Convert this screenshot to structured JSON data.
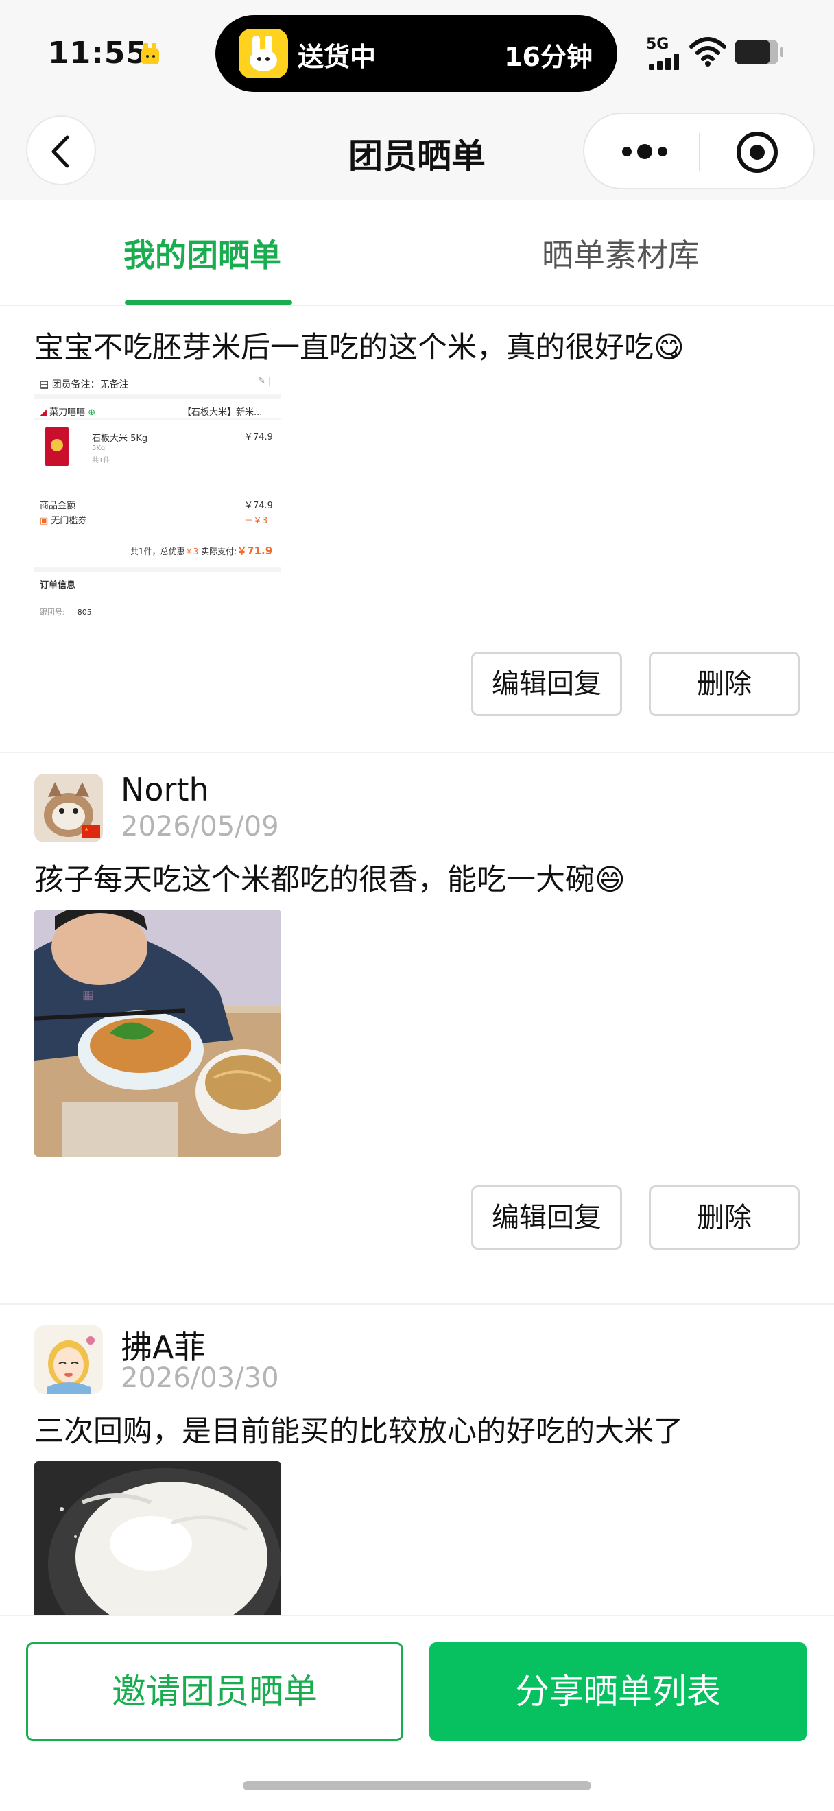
{
  "status_bar": {
    "time": "11:55",
    "island_text": "送货中",
    "island_eta": "16分钟",
    "network": "5G"
  },
  "nav": {
    "title": "团员晒单"
  },
  "tabs": [
    {
      "label": "我的团晒单",
      "active": true
    },
    {
      "label": "晒单素材库",
      "active": false
    }
  ],
  "posts": [
    {
      "text": "宝宝不吃胚芽米后一直吃的这个米，真的很好吃😋",
      "image_kind": "order-screenshot",
      "order": {
        "note_label": "团员备注：无备注",
        "shop": "菜刀嘻嘻",
        "product_tag": "【石板大米】新米...",
        "item_name": "石板大米 5Kg",
        "item_spec": "5Kg",
        "item_count": "共1件",
        "item_price": "￥74.9",
        "goods_amount_label": "商品金额",
        "goods_amount": "￥74.9",
        "coupon_label": "无门槛券",
        "coupon_value": "－￥3",
        "summary_prefix": "共1件，总优惠",
        "summary_discount": "￥3",
        "summary_pay_label": "实际支付:",
        "summary_pay": "￥71.9",
        "order_info_title": "订单信息",
        "group_no_label": "跟团号:",
        "group_no": "805"
      },
      "edit_label": "编辑回复",
      "delete_label": "删除"
    },
    {
      "username": "North",
      "date": "2026/05/09",
      "text": "孩子每天吃这个米都吃的很香，能吃一大碗😄",
      "image_kind": "photo-child-eating",
      "edit_label": "编辑回复",
      "delete_label": "删除"
    },
    {
      "username": "拂A菲",
      "date": "2026/03/30",
      "text": "三次回购，是目前能买的比较放心的好吃的大米了",
      "image_kind": "photo-rice-cooker"
    }
  ],
  "bottom": {
    "invite_label": "邀请团员晒单",
    "share_label": "分享晒单列表"
  },
  "colors": {
    "accent_green": "#07c160",
    "tab_green": "#1aad50",
    "date_gray": "#b4b4b4"
  }
}
